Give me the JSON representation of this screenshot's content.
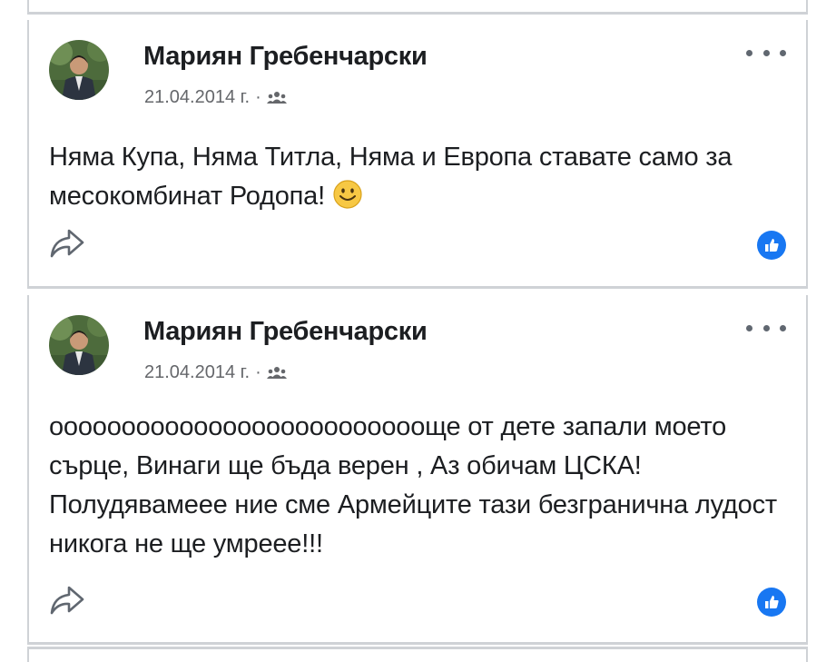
{
  "posts": [
    {
      "author": "Мариян Гребенчарски",
      "date": "21.04.2014 г.",
      "separator": "·",
      "audience_icon": "friends-icon",
      "text": "Няма Купа, Няма Титла, Няма и Европа ставате само за месокомбинат Родопа!",
      "emoji": "smiley-emoji",
      "actions": {
        "share_icon": "share-icon",
        "reaction_icon": "like-reaction-icon"
      }
    },
    {
      "author": "Мариян Гребенчарски",
      "date": "21.04.2014 г.",
      "separator": "·",
      "audience_icon": "friends-icon",
      "text": "ооооооооооооооооооооооооооще от дете запали моето сърце, Винаги ще бъда верен , Аз обичам ЦСКА! Полудявамеее ние сме Армейците тази безгранична лудост никога не ще умреее!!!",
      "actions": {
        "share_icon": "share-icon",
        "reaction_icon": "like-reaction-icon"
      }
    }
  ],
  "colors": {
    "author": "#1c1e21",
    "meta": "#65676b",
    "like_badge": "#1877f2",
    "divider": "#cfd2d6"
  }
}
